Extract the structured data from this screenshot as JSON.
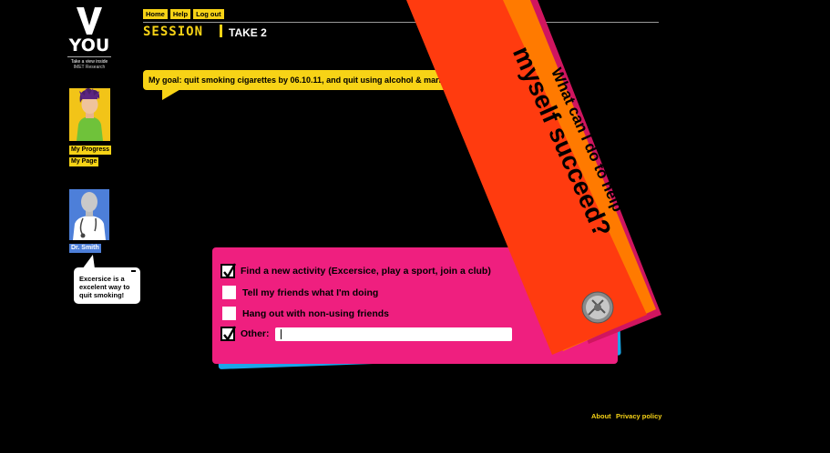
{
  "logo": {
    "big_letter": "V",
    "word": "YOU",
    "tagline": "Take a view inside",
    "org": "IMET Research"
  },
  "nav": {
    "home": "Home",
    "help": "Help",
    "logout": "Log out"
  },
  "session": {
    "label": "SESSION",
    "take": "TAKE 2"
  },
  "sidebar": {
    "progress": "My Progress",
    "page": "My Page",
    "doctor_label": "Dr. Smith"
  },
  "doctor_bubble": {
    "text": "Excersice is a excelent way to quit smoking!"
  },
  "goal": {
    "text": "My goal: quit smoking cigarettes by 06.10.11, and quit using alcohol & marijuana"
  },
  "flag": {
    "line1": "What can I do to help",
    "line2": "myself succeed?"
  },
  "options": [
    {
      "label": "Find  a new activity (Excersice, play a sport, join a club)",
      "checked": true
    },
    {
      "label": "Tell my friends what I'm doing",
      "checked": false
    },
    {
      "label": "Hang out with non-using friends",
      "checked": false
    },
    {
      "label": "Other:",
      "checked": true
    }
  ],
  "other_input": {
    "value": ""
  },
  "footer": {
    "about": "About",
    "privacy": "Privacy policy"
  },
  "colors": {
    "accent": "#f7d316",
    "card_pink": "#ef1f7f",
    "card_blue": "#1aa6e8",
    "flag_red": "#ff3b0f",
    "flag_orange": "#ff7a00",
    "flag_magenta": "#d0155f",
    "doctor_blue": "#4d7fd9"
  }
}
